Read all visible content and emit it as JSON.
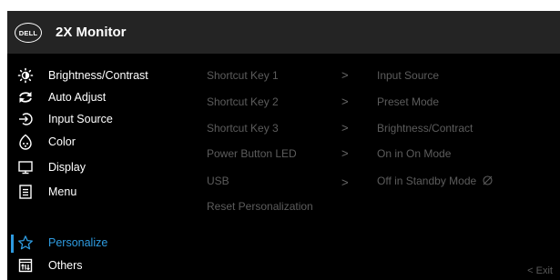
{
  "header": {
    "logo_text": "DELL",
    "title": "2X Monitor"
  },
  "menu": {
    "items": [
      {
        "label": "Brightness/Contrast",
        "icon": "brightness-icon"
      },
      {
        "label": "Auto Adjust",
        "icon": "auto-adjust-icon"
      },
      {
        "label": "Input Source",
        "icon": "input-source-icon"
      },
      {
        "label": "Color",
        "icon": "color-icon"
      },
      {
        "label": "Display",
        "icon": "display-icon"
      },
      {
        "label": "Menu",
        "icon": "menu-icon"
      },
      {
        "label": "Personalize",
        "icon": "star-icon",
        "active": true
      },
      {
        "label": "Others",
        "icon": "others-icon"
      }
    ]
  },
  "personalize": {
    "rows": [
      {
        "label": "Shortcut Key 1",
        "arrow": ">",
        "value": "Input Source"
      },
      {
        "label": "Shortcut Key 2",
        "arrow": ">",
        "value": "Preset Mode"
      },
      {
        "label": "Shortcut Key 3",
        "arrow": ">",
        "value": "Brightness/Contract"
      },
      {
        "label": "Power Button LED",
        "arrow": ">",
        "value": "On in On Mode"
      },
      {
        "label": "USB",
        "arrow": ">",
        "value": "Off in Standby Mode"
      },
      {
        "label": "Reset Personalization"
      }
    ]
  },
  "footer": {
    "exit_label": "< Exit"
  },
  "colors": {
    "accent": "#2e9be0",
    "header_bg": "#242424",
    "panel_bg": "#000000",
    "dim_text": "#5c5c5c"
  }
}
